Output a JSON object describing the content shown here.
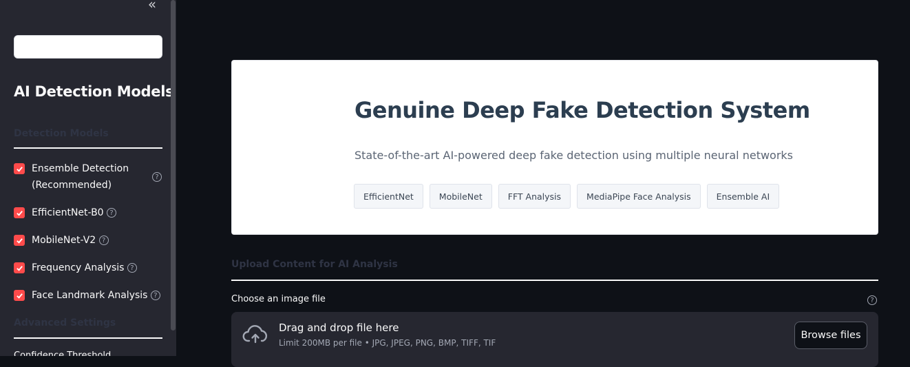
{
  "sidebar": {
    "collapse_glyph": "«",
    "search_value": "",
    "title": "AI Detection Models",
    "section_models": "Detection Models",
    "section_advanced": "Advanced Settings",
    "partial_label": "Confidence Threshold",
    "help_glyph": "?",
    "models": [
      {
        "label": "Ensemble Detection",
        "label2": "(Recommended)",
        "checked": true
      },
      {
        "label": "EfficientNet-B0",
        "checked": true
      },
      {
        "label": "MobileNet-V2",
        "checked": true
      },
      {
        "label": "Frequency Analysis",
        "checked": true
      },
      {
        "label": "Face Landmark Analysis",
        "checked": true
      }
    ]
  },
  "hero": {
    "title": "Genuine Deep Fake Detection System",
    "subtitle": "State-of-the-art AI-powered deep fake detection using multiple neural networks",
    "tags": [
      "EfficientNet",
      "MobileNet",
      "FFT Analysis",
      "MediaPipe Face Analysis",
      "Ensemble AI"
    ]
  },
  "upload": {
    "heading": "Upload Content for AI Analysis",
    "file_label": "Choose an image file",
    "drop_title": "Drag and drop file here",
    "drop_limit": "Limit 200MB per file • JPG, JPEG, PNG, BMP, TIFF, TIF",
    "browse_label": "Browse files"
  },
  "colors": {
    "accent": "#ff4b4b",
    "sidebar_bg": "#262730",
    "main_bg": "#0e1117",
    "hero_title": "#2c3e50"
  }
}
